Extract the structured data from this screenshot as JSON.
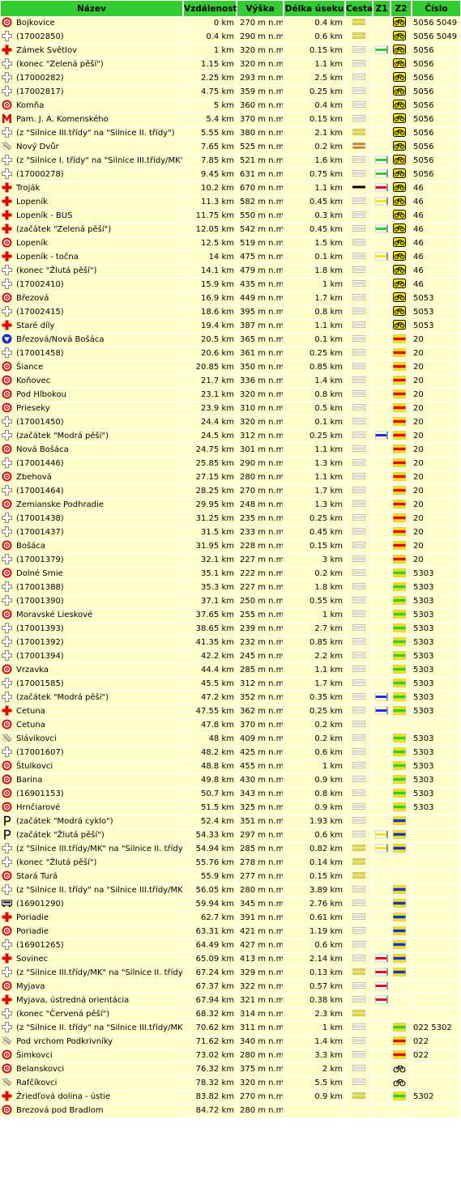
{
  "header": {
    "nazev": "Název",
    "vzdalenost": "Vzdálenost",
    "vyska": "Výška",
    "delka": "Délka úseku",
    "cesta": "Cesta",
    "z1": "Z1",
    "z2": "Z2",
    "cislo": "Číslo"
  },
  "marker_colors": {
    "yellow": "#f2e600",
    "green": "#33cc33",
    "red": "#e8001c",
    "blue": "#1d2fd8",
    "orange": "#e07a00",
    "black": "#000000",
    "white": "#ffffff"
  },
  "rows": [
    {
      "icon": "stop-icon",
      "name": "Bojkovice",
      "dist": "0 km",
      "alt": "270 m n.m.",
      "len": "0.4 km",
      "road": "yellow-double",
      "z1": "",
      "z2": "cyclo",
      "num": "5056 5049"
    },
    {
      "icon": "junction-icon",
      "name": "(17002850)",
      "dist": "0.4 km",
      "alt": "290 m n.m.",
      "len": "0.6 km",
      "road": "yellow-double",
      "z1": "",
      "z2": "cyclo",
      "num": "5056 5049"
    },
    {
      "icon": "redcross-icon",
      "name": "Zámek Světlov",
      "dist": "1 km",
      "alt": "320 m n.m.",
      "len": "0.15 km",
      "road": "white-double",
      "z1": "green",
      "z2": "cyclo",
      "num": "5056"
    },
    {
      "icon": "junction-icon",
      "name": "(konec \"Zelená pěší\")",
      "dist": "1.15 km",
      "alt": "320 m n.m.",
      "len": "1.1 km",
      "road": "white-double",
      "z1": "",
      "z2": "cyclo",
      "num": "5056"
    },
    {
      "icon": "junction-icon",
      "name": "(17000282)",
      "dist": "2.25 km",
      "alt": "293 m n.m.",
      "len": "2.5 km",
      "road": "white-double",
      "z1": "",
      "z2": "cyclo",
      "num": "5056"
    },
    {
      "icon": "junction-icon",
      "name": "(17002817)",
      "dist": "4.75 km",
      "alt": "359 m n.m.",
      "len": "0.25 km",
      "road": "white-double",
      "z1": "",
      "z2": "cyclo",
      "num": "5056"
    },
    {
      "icon": "stop-icon",
      "name": "Komňa",
      "dist": "5 km",
      "alt": "360 m n.m.",
      "len": "0.4 km",
      "road": "white-double",
      "z1": "",
      "z2": "cyclo",
      "num": "5056"
    },
    {
      "icon": "monument-icon",
      "name": "Pam. J. A. Komenského",
      "dist": "5.4 km",
      "alt": "370 m n.m.",
      "len": "0.15 km",
      "road": "white-double",
      "z1": "",
      "z2": "cyclo",
      "num": "5056"
    },
    {
      "icon": "junction-icon",
      "name": "(z \"Silnice III.třídy\" na \"Silnice II. třídy\")",
      "dist": "5.55 km",
      "alt": "380 m n.m.",
      "len": "2.1 km",
      "road": "yellow-double",
      "z1": "",
      "z2": "cyclo",
      "num": "5056"
    },
    {
      "icon": "settlement-icon",
      "name": "Nový Dvůr",
      "dist": "7.65 km",
      "alt": "525 m n.m.",
      "len": "0.2 km",
      "road": "orange-double",
      "z1": "",
      "z2": "cyclo",
      "num": "5056"
    },
    {
      "icon": "junction-icon",
      "name": "(z \"Silnice I. třídy\" na \"Silnice III.třídy/MK\")",
      "dist": "7.85 km",
      "alt": "521 m n.m.",
      "len": "1.6 km",
      "road": "white-double",
      "z1": "green",
      "z2": "cyclo",
      "num": "5056"
    },
    {
      "icon": "junction-icon",
      "name": "(17000278)",
      "dist": "9.45 km",
      "alt": "631 m n.m.",
      "len": "0.75 km",
      "road": "white-double",
      "z1": "green",
      "z2": "cyclo",
      "num": "5056"
    },
    {
      "icon": "redcross-icon",
      "name": "Troják",
      "dist": "10.2 km",
      "alt": "670 m n.m.",
      "len": "1.1 km",
      "road": "black-line",
      "z1": "red",
      "z2": "cyclo",
      "num": "46"
    },
    {
      "icon": "redcross-icon",
      "name": "Lopeník",
      "dist": "11.3 km",
      "alt": "582 m n.m.",
      "len": "0.45 km",
      "road": "white-double",
      "z1": "yellow",
      "z2": "cyclo",
      "num": "46"
    },
    {
      "icon": "redcross-icon",
      "name": "Lopeník - BUS",
      "dist": "11.75 km",
      "alt": "550 m n.m.",
      "len": "0.3 km",
      "road": "white-double",
      "z1": "",
      "z2": "cyclo",
      "num": "46"
    },
    {
      "icon": "redcross-icon",
      "name": "(začátek \"Zelená pěší\")",
      "dist": "12.05 km",
      "alt": "542 m n.m.",
      "len": "0.45 km",
      "road": "white-double",
      "z1": "green",
      "z2": "cyclo",
      "num": "46"
    },
    {
      "icon": "stop-icon",
      "name": "Lopeník",
      "dist": "12.5 km",
      "alt": "519 m n.m.",
      "len": "1.5 km",
      "road": "white-double",
      "z1": "",
      "z2": "cyclo",
      "num": "46"
    },
    {
      "icon": "redcross-icon",
      "name": "Lopeník - točna",
      "dist": "14 km",
      "alt": "475 m n.m.",
      "len": "0.1 km",
      "road": "white-double",
      "z1": "yellow",
      "z2": "cyclo",
      "num": "46"
    },
    {
      "icon": "junction-icon",
      "name": "(konec \"Žlutá pěší\")",
      "dist": "14.1 km",
      "alt": "479 m n.m.",
      "len": "1.8 km",
      "road": "white-double",
      "z1": "",
      "z2": "cyclo",
      "num": "46"
    },
    {
      "icon": "junction-icon",
      "name": "(17002410)",
      "dist": "15.9 km",
      "alt": "435 m n.m.",
      "len": "1 km",
      "road": "white-double",
      "z1": "",
      "z2": "cyclo",
      "num": "46"
    },
    {
      "icon": "stop-icon",
      "name": "Březová",
      "dist": "16.9 km",
      "alt": "449 m n.m.",
      "len": "1.7 km",
      "road": "white-double",
      "z1": "",
      "z2": "cyclo",
      "num": "5053"
    },
    {
      "icon": "junction-icon",
      "name": "(17002415)",
      "dist": "18.6 km",
      "alt": "395 m n.m.",
      "len": "0.8 km",
      "road": "white-double",
      "z1": "",
      "z2": "cyclo",
      "num": "5053"
    },
    {
      "icon": "redcross-icon",
      "name": "Staré díly",
      "dist": "19.4 km",
      "alt": "387 m n.m.",
      "len": "1.1 km",
      "road": "white-double",
      "z1": "",
      "z2": "cyclo",
      "num": "5053"
    },
    {
      "icon": "border-icon",
      "name": "Březová/Nová Bošáca",
      "dist": "20.5 km",
      "alt": "365 m n.m.",
      "len": "0.1 km",
      "road": "white-double",
      "z1": "",
      "z2": "red-yellow",
      "num": "20"
    },
    {
      "icon": "junction-icon",
      "name": "(17001458)",
      "dist": "20.6 km",
      "alt": "361 m n.m.",
      "len": "0.25 km",
      "road": "white-double",
      "z1": "",
      "z2": "red-yellow",
      "num": "20"
    },
    {
      "icon": "stop-icon",
      "name": "Šiance",
      "dist": "20.85 km",
      "alt": "350 m n.m.",
      "len": "0.85 km",
      "road": "white-double",
      "z1": "",
      "z2": "red-yellow",
      "num": "20"
    },
    {
      "icon": "stop-icon",
      "name": "Koňovec",
      "dist": "21.7 km",
      "alt": "336 m n.m.",
      "len": "1.4 km",
      "road": "white-double",
      "z1": "",
      "z2": "red-yellow",
      "num": "20"
    },
    {
      "icon": "stop-icon",
      "name": "Pod Hlbokou",
      "dist": "23.1 km",
      "alt": "320 m n.m.",
      "len": "0.8 km",
      "road": "white-double",
      "z1": "",
      "z2": "red-yellow",
      "num": "20"
    },
    {
      "icon": "stop-icon",
      "name": "Prieseky",
      "dist": "23.9 km",
      "alt": "310 m n.m.",
      "len": "0.5 km",
      "road": "white-double",
      "z1": "",
      "z2": "red-yellow",
      "num": "20"
    },
    {
      "icon": "junction-icon",
      "name": "(17001450)",
      "dist": "24.4 km",
      "alt": "320 m n.m.",
      "len": "0.1 km",
      "road": "white-double",
      "z1": "",
      "z2": "red-yellow",
      "num": "20"
    },
    {
      "icon": "junction-icon",
      "name": "(začátek \"Modrá pěší\")",
      "dist": "24.5 km",
      "alt": "312 m n.m.",
      "len": "0.25 km",
      "road": "white-double",
      "z1": "blue",
      "z2": "red-yellow",
      "num": "20"
    },
    {
      "icon": "stop-icon",
      "name": "Nová Bošáca",
      "dist": "24.75 km",
      "alt": "301 m n.m.",
      "len": "1.1 km",
      "road": "white-double",
      "z1": "",
      "z2": "red-yellow",
      "num": "20"
    },
    {
      "icon": "junction-icon",
      "name": "(17001446)",
      "dist": "25.85 km",
      "alt": "290 m n.m.",
      "len": "1.3 km",
      "road": "white-double",
      "z1": "",
      "z2": "red-yellow",
      "num": "20"
    },
    {
      "icon": "stop-icon",
      "name": "Zbehová",
      "dist": "27.15 km",
      "alt": "280 m n.m.",
      "len": "1.1 km",
      "road": "white-double",
      "z1": "",
      "z2": "red-yellow",
      "num": "20"
    },
    {
      "icon": "junction-icon",
      "name": "(17001464)",
      "dist": "28.25 km",
      "alt": "270 m n.m.",
      "len": "1.7 km",
      "road": "white-double",
      "z1": "",
      "z2": "red-yellow",
      "num": "20"
    },
    {
      "icon": "stop-icon",
      "name": "Zemianske Podhradie",
      "dist": "29.95 km",
      "alt": "248 m n.m.",
      "len": "1.3 km",
      "road": "white-double",
      "z1": "",
      "z2": "red-yellow",
      "num": "20"
    },
    {
      "icon": "junction-icon",
      "name": "(17001438)",
      "dist": "31.25 km",
      "alt": "235 m n.m.",
      "len": "0.25 km",
      "road": "white-double",
      "z1": "",
      "z2": "red-yellow",
      "num": "20"
    },
    {
      "icon": "junction-icon",
      "name": "(17001437)",
      "dist": "31.5 km",
      "alt": "233 m n.m.",
      "len": "0.45 km",
      "road": "white-double",
      "z1": "",
      "z2": "red-yellow",
      "num": "20"
    },
    {
      "icon": "stop-icon",
      "name": "Bošáca",
      "dist": "31.95 km",
      "alt": "228 m n.m.",
      "len": "0.15 km",
      "road": "white-double",
      "z1": "",
      "z2": "red-yellow",
      "num": "20"
    },
    {
      "icon": "junction-icon",
      "name": "(17001379)",
      "dist": "32.1 km",
      "alt": "227 m n.m.",
      "len": "3 km",
      "road": "white-double",
      "z1": "",
      "z2": "red-yellow",
      "num": "20"
    },
    {
      "icon": "stop-icon",
      "name": "Dolné Srnie",
      "dist": "35.1 km",
      "alt": "222 m n.m.",
      "len": "0.2 km",
      "road": "white-double",
      "z1": "",
      "z2": "green-yellow",
      "num": "5303"
    },
    {
      "icon": "junction-icon",
      "name": "(17001388)",
      "dist": "35.3 km",
      "alt": "227 m n.m.",
      "len": "1.8 km",
      "road": "white-double",
      "z1": "",
      "z2": "green-yellow",
      "num": "5303"
    },
    {
      "icon": "junction-icon",
      "name": "(17001390)",
      "dist": "37.1 km",
      "alt": "250 m n.m.",
      "len": "0.55 km",
      "road": "white-double",
      "z1": "",
      "z2": "green-yellow",
      "num": "5303"
    },
    {
      "icon": "stop-icon",
      "name": "Moravské Lieskové",
      "dist": "37.65 km",
      "alt": "255 m n.m.",
      "len": "1 km",
      "road": "white-double",
      "z1": "",
      "z2": "green-yellow",
      "num": "5303"
    },
    {
      "icon": "junction-icon",
      "name": "(17001393)",
      "dist": "38.65 km",
      "alt": "239 m n.m.",
      "len": "2.7 km",
      "road": "white-double",
      "z1": "",
      "z2": "green-yellow",
      "num": "5303"
    },
    {
      "icon": "junction-icon",
      "name": "(17001392)",
      "dist": "41.35 km",
      "alt": "232 m n.m.",
      "len": "0.85 km",
      "road": "white-double",
      "z1": "",
      "z2": "green-yellow",
      "num": "5303"
    },
    {
      "icon": "junction-icon",
      "name": "(17001394)",
      "dist": "42.2 km",
      "alt": "245 m n.m.",
      "len": "2.2 km",
      "road": "white-double",
      "z1": "",
      "z2": "green-yellow",
      "num": "5303"
    },
    {
      "icon": "stop-icon",
      "name": "Vrzavka",
      "dist": "44.4 km",
      "alt": "285 m n.m.",
      "len": "1.1 km",
      "road": "white-double",
      "z1": "",
      "z2": "green-yellow",
      "num": "5303"
    },
    {
      "icon": "junction-icon",
      "name": "(17001585)",
      "dist": "45.5 km",
      "alt": "312 m n.m.",
      "len": "1.7 km",
      "road": "white-double",
      "z1": "",
      "z2": "green-yellow",
      "num": "5303"
    },
    {
      "icon": "junction-icon",
      "name": "(začátek \"Modrá pěší\")",
      "dist": "47.2 km",
      "alt": "352 m n.m.",
      "len": "0.35 km",
      "road": "white-double",
      "z1": "blue",
      "z2": "green-yellow",
      "num": "5303"
    },
    {
      "icon": "redcross-icon",
      "name": "Cetuna",
      "dist": "47.55 km",
      "alt": "362 m n.m.",
      "len": "0.25 km",
      "road": "white-double",
      "z1": "blue",
      "z2": "green-yellow",
      "num": "5303"
    },
    {
      "icon": "stop-icon",
      "name": "Cetuna",
      "dist": "47.8 km",
      "alt": "370 m n.m.",
      "len": "0.2 km",
      "road": "white-double",
      "z1": "",
      "z2": "",
      "num": ""
    },
    {
      "icon": "settlement-icon",
      "name": "Slávikovci",
      "dist": "48 km",
      "alt": "409 m n.m.",
      "len": "0.2 km",
      "road": "white-double",
      "z1": "",
      "z2": "green-yellow",
      "num": "5303"
    },
    {
      "icon": "junction-icon",
      "name": "(17001607)",
      "dist": "48.2 km",
      "alt": "425 m n.m.",
      "len": "0.6 km",
      "road": "white-double",
      "z1": "",
      "z2": "green-yellow",
      "num": "5303"
    },
    {
      "icon": "stop-icon",
      "name": "Štulkovci",
      "dist": "48.8 km",
      "alt": "455 m n.m.",
      "len": "1 km",
      "road": "white-double",
      "z1": "",
      "z2": "green-yellow",
      "num": "5303"
    },
    {
      "icon": "stop-icon",
      "name": "Barina",
      "dist": "49.8 km",
      "alt": "430 m n.m.",
      "len": "0.9 km",
      "road": "white-double",
      "z1": "",
      "z2": "green-yellow",
      "num": "5303"
    },
    {
      "icon": "stop-icon",
      "name": "(16901153)",
      "dist": "50.7 km",
      "alt": "343 m n.m.",
      "len": "0.8 km",
      "road": "white-double",
      "z1": "",
      "z2": "green-yellow",
      "num": "5303"
    },
    {
      "icon": "stop-icon",
      "name": "Hrnčiarové",
      "dist": "51.5 km",
      "alt": "325 m n.m.",
      "len": "0.9 km",
      "road": "white-double",
      "z1": "",
      "z2": "green-yellow",
      "num": "5303"
    },
    {
      "icon": "signpost-icon",
      "name": "(začátek \"Modrá cyklo\")",
      "dist": "52.4 km",
      "alt": "351 m n.m.",
      "len": "1.93 km",
      "road": "white-double",
      "z1": "",
      "z2": "blue-yellow",
      "num": ""
    },
    {
      "icon": "signpost-icon",
      "name": "(začátek \"Žlutá pěší\")",
      "dist": "54.33 km",
      "alt": "297 m n.m.",
      "len": "0.6 km",
      "road": "white-double",
      "z1": "yellow",
      "z2": "blue-yellow",
      "num": ""
    },
    {
      "icon": "junction-icon",
      "name": "(z \"Silnice III.třídy/MK\" na \"Silnice II. třídy\")",
      "dist": "54.94 km",
      "alt": "285 m n.m.",
      "len": "0.82 km",
      "road": "yellow-double",
      "z1": "yellow",
      "z2": "blue-yellow",
      "num": ""
    },
    {
      "icon": "junction-icon",
      "name": "(konec \"Žlutá pěší\")",
      "dist": "55.76 km",
      "alt": "278 m n.m.",
      "len": "0.14 km",
      "road": "yellow-double",
      "z1": "",
      "z2": "",
      "num": ""
    },
    {
      "icon": "stop-icon",
      "name": "Stará Turá",
      "dist": "55.9 km",
      "alt": "277 m n.m.",
      "len": "0.15 km",
      "road": "yellow-double",
      "z1": "",
      "z2": "",
      "num": ""
    },
    {
      "icon": "junction-icon",
      "name": "(z \"Silnice II. třídy\" na \"Silnice III.třídy/MK\")",
      "dist": "56.05 km",
      "alt": "280 m n.m.",
      "len": "3.89 km",
      "road": "white-double",
      "z1": "",
      "z2": "blue-yellow",
      "num": ""
    },
    {
      "icon": "busstop-icon",
      "name": "(16901290)",
      "dist": "59.94 km",
      "alt": "345 m n.m.",
      "len": "2.76 km",
      "road": "white-double",
      "z1": "",
      "z2": "blue-yellow",
      "num": ""
    },
    {
      "icon": "redcross-icon",
      "name": "Poriadie",
      "dist": "62.7 km",
      "alt": "391 m n.m.",
      "len": "0.61 km",
      "road": "white-double",
      "z1": "",
      "z2": "blue-yellow",
      "num": ""
    },
    {
      "icon": "stop-icon",
      "name": "Poriadie",
      "dist": "63.31 km",
      "alt": "421 m n.m.",
      "len": "1.19 km",
      "road": "white-double",
      "z1": "",
      "z2": "blue-yellow",
      "num": ""
    },
    {
      "icon": "junction-icon",
      "name": "(16901265)",
      "dist": "64.49 km",
      "alt": "427 m n.m.",
      "len": "0.6 km",
      "road": "white-double",
      "z1": "",
      "z2": "blue-yellow",
      "num": ""
    },
    {
      "icon": "redcross-icon",
      "name": "Sovinec",
      "dist": "65.09 km",
      "alt": "413 m n.m.",
      "len": "2.14 km",
      "road": "white-double",
      "z1": "red",
      "z2": "blue-yellow",
      "num": ""
    },
    {
      "icon": "junction-icon",
      "name": "(z \"Silnice III.třídy/MK\" na \"Silnice II. třídy\")",
      "dist": "67.24 km",
      "alt": "329 m n.m.",
      "len": "0.13 km",
      "road": "yellow-double",
      "z1": "red",
      "z2": "blue-yellow",
      "num": ""
    },
    {
      "icon": "stop-icon",
      "name": "Myjava",
      "dist": "67.37 km",
      "alt": "322 m n.m.",
      "len": "0.57 km",
      "road": "white-double",
      "z1": "red",
      "z2": "",
      "num": ""
    },
    {
      "icon": "redcross-icon",
      "name": "Myjava, ústredná orientácia",
      "dist": "67.94 km",
      "alt": "321 m n.m.",
      "len": "0.38 km",
      "road": "white-double",
      "z1": "red",
      "z2": "",
      "num": ""
    },
    {
      "icon": "junction-icon",
      "name": "(konec \"Červená pěší\")",
      "dist": "68.32 km",
      "alt": "314 m n.m.",
      "len": "2.3 km",
      "road": "yellow-double",
      "z1": "",
      "z2": "",
      "num": ""
    },
    {
      "icon": "junction-icon",
      "name": "(z \"Silnice II. třídy\" na \"Silnice III.třídy/MK\")",
      "dist": "70.62 km",
      "alt": "311 m n.m.",
      "len": "1 km",
      "road": "white-double",
      "z1": "",
      "z2": "green-yellow",
      "num": "022 5302"
    },
    {
      "icon": "settlement-icon",
      "name": "Pod vrchom Podkrivníky",
      "dist": "71.62 km",
      "alt": "340 m n.m.",
      "len": "1.4 km",
      "road": "white-double",
      "z1": "",
      "z2": "red-yellow",
      "num": "022"
    },
    {
      "icon": "stop-icon",
      "name": "Šimkovci",
      "dist": "73.02 km",
      "alt": "280 m n.m.",
      "len": "3.3 km",
      "road": "white-double",
      "z1": "",
      "z2": "red-yellow",
      "num": "022"
    },
    {
      "icon": "stop-icon",
      "name": "Belanskovci",
      "dist": "76.32 km",
      "alt": "375 m n.m.",
      "len": "2 km",
      "road": "white-double",
      "z1": "",
      "z2": "bike",
      "num": ""
    },
    {
      "icon": "settlement-icon",
      "name": "Rafčíkovci",
      "dist": "78.32 km",
      "alt": "320 m n.m.",
      "len": "5.5 km",
      "road": "white-double",
      "z1": "",
      "z2": "bike",
      "num": ""
    },
    {
      "icon": "redcross-icon",
      "name": "Žriedľová dolina - ústie",
      "dist": "83.82 km",
      "alt": "270 m n.m.",
      "len": "0.9 km",
      "road": "yellow-double",
      "z1": "",
      "z2": "green-yellow",
      "num": "5302"
    },
    {
      "icon": "stop-icon",
      "name": "Brezová pod Bradlom",
      "dist": "84.72 km",
      "alt": "280 m n.m.",
      "len": "",
      "road": "",
      "z1": "",
      "z2": "",
      "num": ""
    }
  ]
}
